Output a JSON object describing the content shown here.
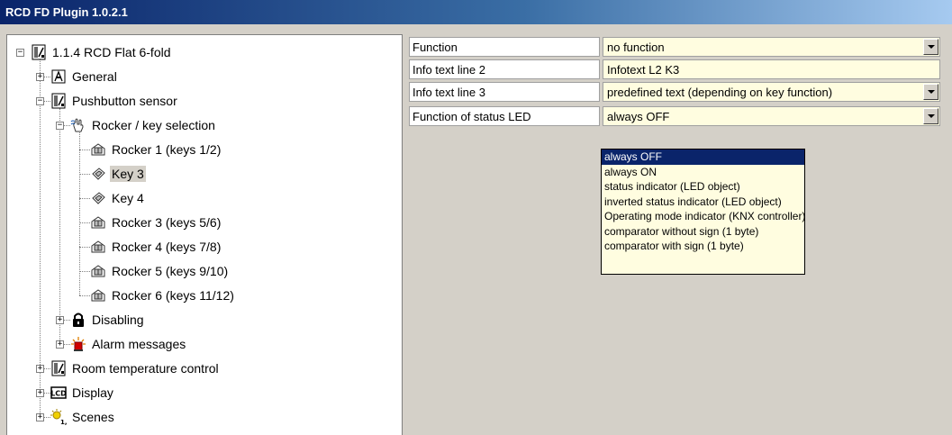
{
  "window": {
    "title": "RCD FD Plugin 1.0.2.1"
  },
  "tree": [
    {
      "label": "1.1.4  RCD Flat 6-fold",
      "icon": "device-icon",
      "expander": "minus"
    },
    {
      "label": "General",
      "icon": "general-icon",
      "expander": "plus"
    },
    {
      "label": "Pushbutton sensor",
      "icon": "device-icon",
      "expander": "minus"
    },
    {
      "label": "Rocker / key selection",
      "icon": "hand-icon",
      "expander": "minus"
    },
    {
      "label": "Rocker 1 (keys 1/2)",
      "icon": "rocker-icon",
      "expander": "none"
    },
    {
      "label": "Key 3",
      "icon": "key-icon",
      "expander": "none",
      "selected": true
    },
    {
      "label": "Key 4",
      "icon": "key-icon",
      "expander": "none"
    },
    {
      "label": "Rocker 3 (keys 5/6)",
      "icon": "rocker-icon",
      "expander": "none"
    },
    {
      "label": "Rocker 4 (keys 7/8)",
      "icon": "rocker-icon",
      "expander": "none"
    },
    {
      "label": "Rocker 5 (keys 9/10)",
      "icon": "rocker-icon",
      "expander": "none"
    },
    {
      "label": "Rocker 6 (keys 11/12)",
      "icon": "rocker-icon",
      "expander": "none"
    },
    {
      "label": "Disabling",
      "icon": "lock-icon",
      "expander": "plus"
    },
    {
      "label": "Alarm messages",
      "icon": "alarm-icon",
      "expander": "plus"
    },
    {
      "label": "Room temperature control",
      "icon": "device-icon",
      "expander": "plus"
    },
    {
      "label": "Display",
      "icon": "lcd-icon",
      "expander": "plus"
    },
    {
      "label": "Scenes",
      "icon": "scenes-icon",
      "expander": "plus"
    }
  ],
  "params": [
    {
      "label": "Function",
      "value": "no function",
      "type": "dropdown"
    },
    {
      "label": "Info text line 2",
      "value": "Infotext L2 K3",
      "type": "text"
    },
    {
      "label": "Info text line 3",
      "value": "predefined text (depending on key function)",
      "type": "dropdown"
    },
    {
      "label": "Function of status LED",
      "value": "always OFF",
      "type": "dropdown"
    }
  ],
  "dropdown": {
    "options": [
      "always OFF",
      "always ON",
      "status indicator (LED object)",
      "inverted status indicator (LED object)",
      "Operating mode indicator (KNX controller)",
      "comparator without sign (1 byte)",
      "comparator with sign (1 byte)"
    ],
    "selected_index": 0
  },
  "colors": {
    "title_bar": "#0a246a",
    "value_field": "#fffde0",
    "selection": "#0a246a"
  }
}
